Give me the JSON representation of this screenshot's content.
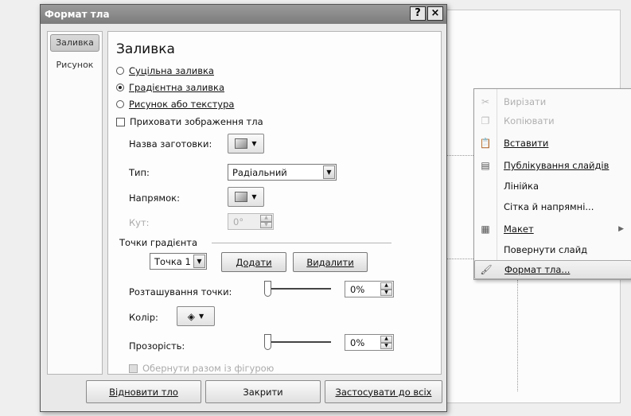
{
  "dialog": {
    "title": "Формат тла",
    "help_btn": "?",
    "close_btn": "×",
    "nav": [
      "Заливка",
      "Рисунок"
    ],
    "heading": "Заливка",
    "fill_options": [
      {
        "label": "Суцільна заливка",
        "selected": false
      },
      {
        "label": "Градієнтна заливка",
        "selected": true
      },
      {
        "label": "Рисунок або текстура",
        "selected": false
      }
    ],
    "hide_graphics": "Приховати зображення тла",
    "preset_label": "Назва заготовки:",
    "type_label": "Тип:",
    "type_value": "Радіальний",
    "direction_label": "Напрямок:",
    "angle_label": "Кут:",
    "angle_value": "0°",
    "stops_title": "Точки градієнта",
    "stop_select": "Точка 1",
    "add_btn": "Додати",
    "remove_btn": "Видалити",
    "position_label": "Розташування точки:",
    "position_value": "0%",
    "position_fraction": 0,
    "color_label": "Колір:",
    "transparency_label": "Прозорість:",
    "transparency_value": "0%",
    "transparency_fraction": 0,
    "rotate_with_shape": "Обернути разом із фігурою",
    "footer": {
      "reset": "Відновити тло",
      "close": "Закрити",
      "apply_all": "Застосувати до всіх"
    }
  },
  "context_menu": {
    "items": [
      {
        "label": "Вирізати",
        "icon": "cut-icon",
        "disabled": true
      },
      {
        "label": "Копіювати",
        "icon": "copy-icon",
        "disabled": true
      },
      {
        "label": "Вставити",
        "icon": "paste-icon",
        "disabled": false
      },
      {
        "label": "Публікування слайдів",
        "icon": "publish-icon",
        "disabled": false
      },
      {
        "label": "Лінійка",
        "icon": "",
        "disabled": false
      },
      {
        "label": "Сітка й напрямні...",
        "icon": "",
        "disabled": false
      },
      {
        "label": "Макет",
        "icon": "layout-icon",
        "disabled": false,
        "submenu": true
      },
      {
        "label": "Повернути слайд",
        "icon": "",
        "disabled": false
      },
      {
        "label": "Формат тла...",
        "icon": "format-bg-icon",
        "disabled": false,
        "highlighted": true
      }
    ]
  }
}
